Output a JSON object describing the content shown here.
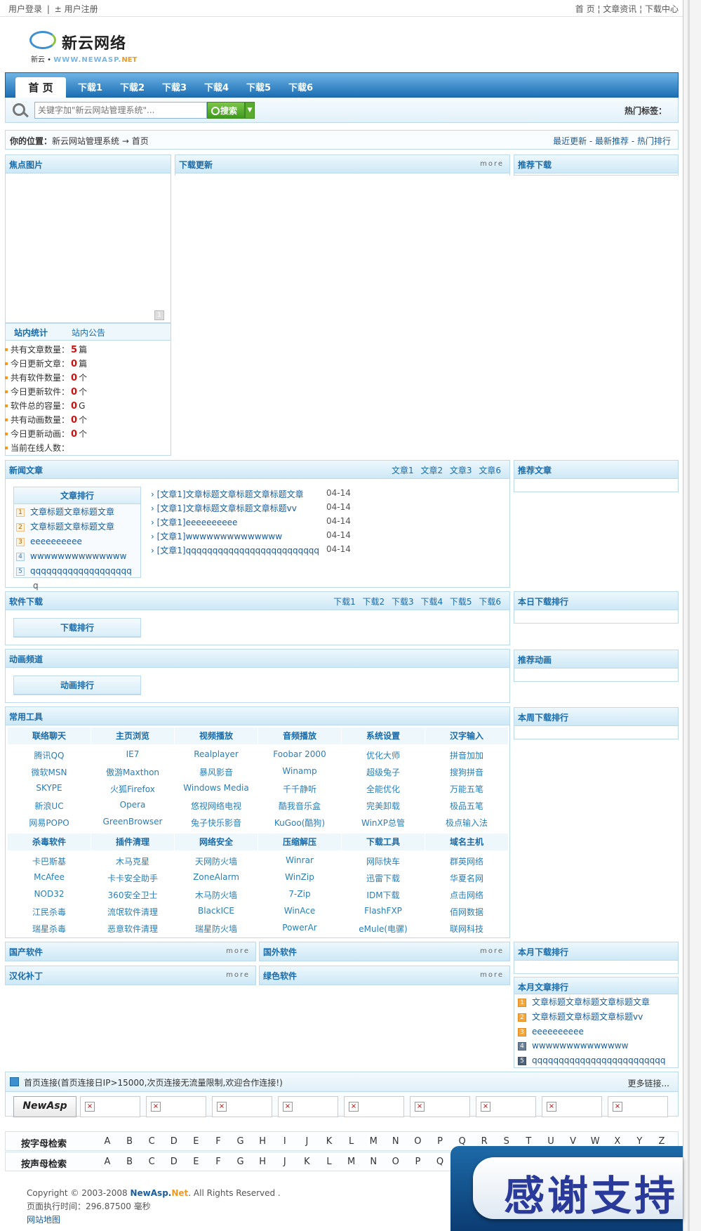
{
  "topbar": {
    "login": "用户登录",
    "sep": "|",
    "register": "± 用户注册",
    "home": "首 页",
    "news": "¦ 文章资讯",
    "download": "¦ 下载中心"
  },
  "logo": {
    "title": "新云网络",
    "sub1": "新云 •",
    "sub2": "WWW.NEWASP.",
    "sub3": "NET"
  },
  "nav": {
    "home": "首 页",
    "tabs": [
      "下载1",
      "下载2",
      "下载3",
      "下载4",
      "下载5",
      "下载6"
    ]
  },
  "search": {
    "placeholder": "关键字加\"新云网站管理系统\"...",
    "button": "搜索",
    "dropdown": "▼",
    "hot_label": "热门标签："
  },
  "location": {
    "label": "你的位置：",
    "path": "新云网站管理系统 → 首页",
    "links": "最近更新 - 最新推荐 - 热门排行"
  },
  "focus": {
    "title": "焦点图片",
    "slide_btn": "1"
  },
  "download_update": {
    "title": "下载更新",
    "more": "more"
  },
  "recommend_download": {
    "title": "推荐下载"
  },
  "stats": {
    "tab1": "站内统计",
    "tab2": "站内公告",
    "items": [
      {
        "label": "共有文章数量：",
        "value": "5",
        "unit": "篇"
      },
      {
        "label": "今日更新文章：",
        "value": "0",
        "unit": "篇"
      },
      {
        "label": "共有软件数量：",
        "value": "0",
        "unit": "个"
      },
      {
        "label": "今日更新软件：",
        "value": "0",
        "unit": "个"
      },
      {
        "label": "软件总的容量：",
        "value": "0",
        "unit": "G"
      },
      {
        "label": "共有动画数量：",
        "value": "0",
        "unit": "个"
      },
      {
        "label": "今日更新动画：",
        "value": "0",
        "unit": "个"
      },
      {
        "label": "当前在线人数：",
        "value": "",
        "unit": ""
      }
    ]
  },
  "news": {
    "title": "新闻文章",
    "links": "文章1 文章2 文章3 文章6",
    "rank_title": "文章排行",
    "rank": [
      "文章标题文章标题文章",
      "文章标题文章标题文章",
      "eeeeeeeeee",
      "wwwwwwwwwwwwww",
      "qqqqqqqqqqqqqqqqqqq",
      "q"
    ],
    "articles": [
      {
        "title": "› [文章1]文章标题文章标题文章标题文章",
        "date": "04-14"
      },
      {
        "title": "› [文章1]文章标题文章标题文章标题vv",
        "date": "04-14"
      },
      {
        "title": "› [文章1]eeeeeeeeee",
        "date": "04-14"
      },
      {
        "title": "› [文章1]wwwwwwwwwwwwww",
        "date": "04-14"
      },
      {
        "title": "› [文章1]qqqqqqqqqqqqqqqqqqqqqqqqq",
        "date": "04-14"
      }
    ]
  },
  "recommend_article": {
    "title": "推荐文章"
  },
  "software": {
    "title": "软件下载",
    "links": "下载1 下载2 下载3 下载4 下载5 下载6",
    "rank_title": "下载排行"
  },
  "day_rank": {
    "title": "本日下载排行"
  },
  "anim": {
    "title": "动画频道",
    "rank_title": "动画排行"
  },
  "recommend_anim": {
    "title": "推荐动画"
  },
  "week_rank": {
    "title": "本周下载排行"
  },
  "tools": {
    "title": "常用工具",
    "head1": [
      "联络聊天",
      "主页浏览",
      "视频播放",
      "音频播放",
      "系统设置",
      "汉字输入"
    ],
    "rows1": [
      [
        "腾讯QQ",
        "IE7",
        "Realplayer",
        "Foobar 2000",
        "优化大师",
        "拼音加加"
      ],
      [
        "微软MSN",
        "傲游Maxthon",
        "暴风影音",
        "Winamp",
        "超级兔子",
        "搜狗拼音"
      ],
      [
        "SKYPE",
        "火狐Firefox",
        "Windows Media",
        "千千静听",
        "全能优化",
        "万能五笔"
      ],
      [
        "新浪UC",
        "Opera",
        "悠视网络电视",
        "酷我音乐盒",
        "完美卸载",
        "极品五笔"
      ],
      [
        "网易POPO",
        "GreenBrowser",
        "兔子快乐影音",
        "KuGoo(酷狗)",
        "WinXP总管",
        "极点输入法"
      ]
    ],
    "head2": [
      "杀毒软件",
      "插件清理",
      "网络安全",
      "压缩解压",
      "下载工具",
      "域名主机"
    ],
    "rows2": [
      [
        "卡巴斯基",
        "木马克星",
        "天网防火墙",
        "Winrar",
        "网际快车",
        "群英网络"
      ],
      [
        "McAfee",
        "卡卡安全助手",
        "ZoneAlarm",
        "WinZip",
        "迅雷下载",
        "华夏名网"
      ],
      [
        "NOD32",
        "360安全卫士",
        "木马防火墙",
        "7-Zip",
        "IDM下载",
        "点击网络"
      ],
      [
        "江民杀毒",
        "流氓软件清理",
        "BlackICE",
        "WinAce",
        "FlashFXP",
        "佰网数据"
      ],
      [
        "瑞星杀毒",
        "恶意软件清理",
        "瑞星防火墙",
        "PowerAr",
        "eMule(电骡)",
        "联网科技"
      ]
    ]
  },
  "soft_boxes": [
    {
      "title": "国产软件",
      "more": "more"
    },
    {
      "title": "国外软件",
      "more": "more"
    },
    {
      "title": "汉化补丁",
      "more": "more"
    },
    {
      "title": "绿色软件",
      "more": "more"
    }
  ],
  "month_rank": {
    "title": "本月下载排行"
  },
  "month_article": {
    "title": "本月文章排行",
    "items": [
      "文章标题文章标题文章标题文章",
      "文章标题文章标题文章标题vv",
      "eeeeeeeeee",
      "wwwwwwwwwwwwww",
      "qqqqqqqqqqqqqqqqqqqqqqqqq"
    ]
  },
  "partner": {
    "title": "首页连接(首页连接日IP>15000,次页连接无流量限制,欢迎合作连接!)",
    "more": "更多链接...",
    "logo_text": "NewAsp",
    "x": "×"
  },
  "alpha": {
    "letter_label": "按字母检索",
    "pinyin_label": "按声母检索",
    "letters1": [
      "A",
      "B",
      "C",
      "D",
      "E",
      "F",
      "G",
      "H",
      "I",
      "J",
      "K",
      "L",
      "M",
      "N",
      "O",
      "P",
      "Q",
      "R",
      "S",
      "T",
      "U",
      "V",
      "W",
      "X",
      "Y",
      "Z"
    ],
    "letters2": [
      "A",
      "B",
      "C",
      "D",
      "E",
      "F",
      "G",
      "H",
      "J",
      "K",
      "L",
      "M",
      "N",
      "O",
      "P",
      "Q"
    ]
  },
  "footer": {
    "copy1": "Copyright © 2003-2008 ",
    "brand1": "NewAsp.",
    "brand2": "Net",
    "copy2": ". All Rights Reserved .",
    "time": "页面执行时间：296.87500 毫秒",
    "sitemap": "网站地图"
  },
  "thanks": {
    "text": "感谢支持"
  }
}
